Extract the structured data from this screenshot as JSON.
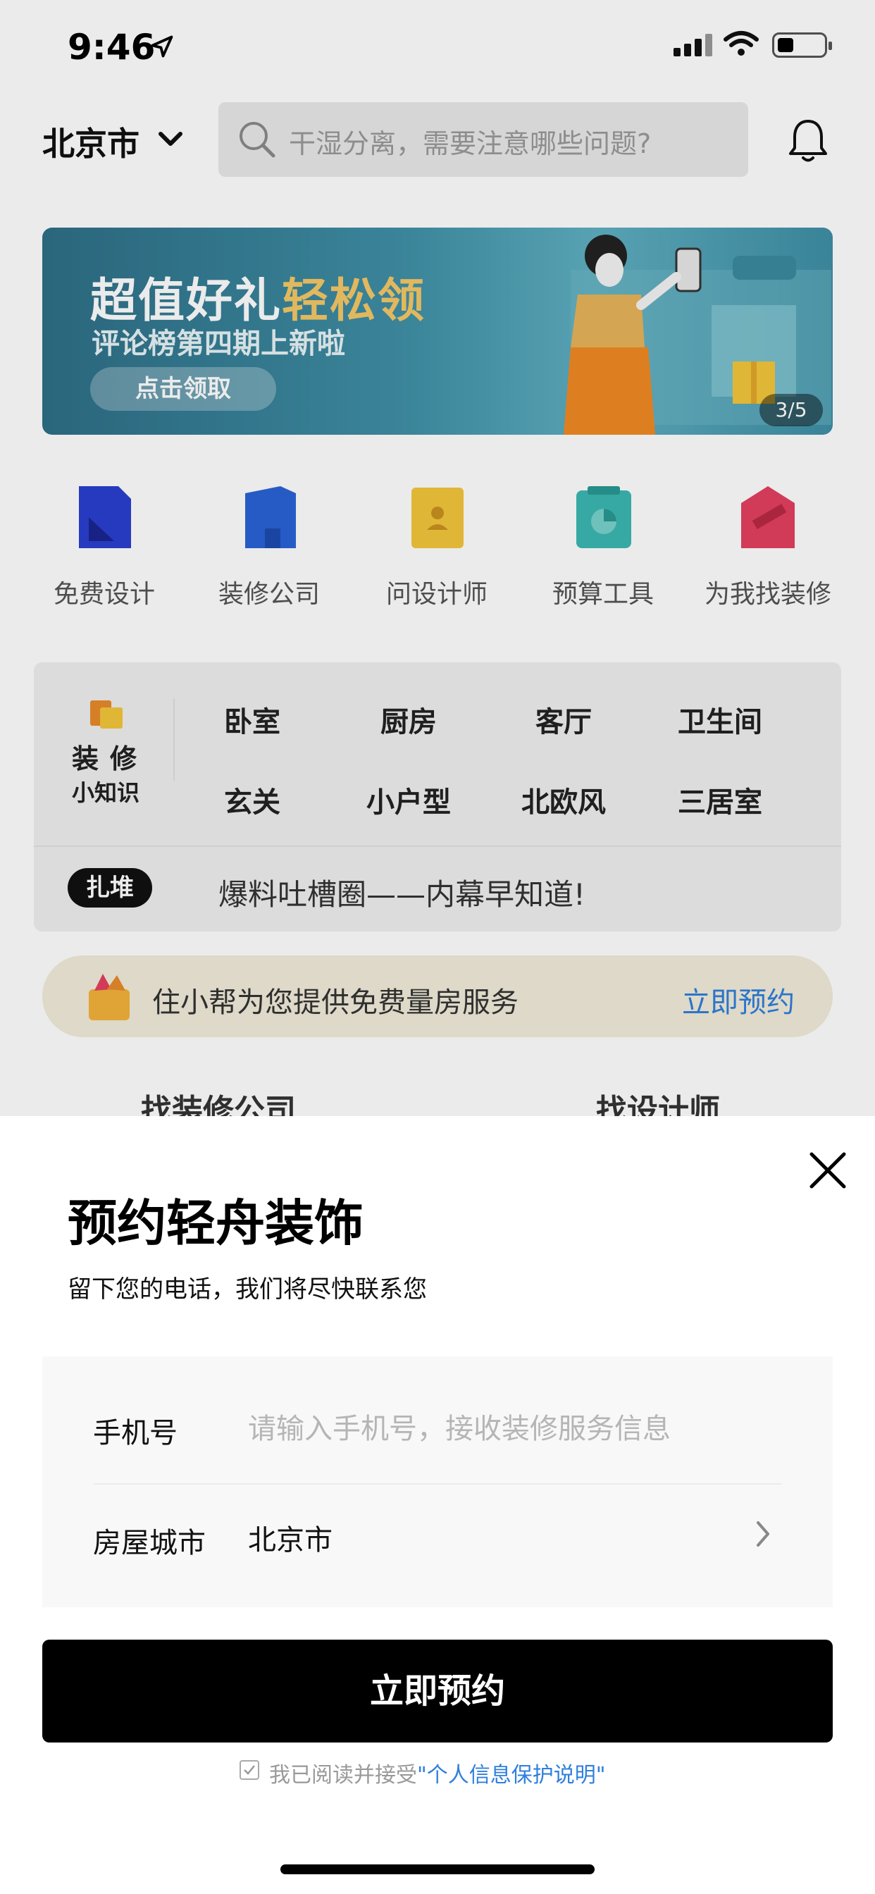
{
  "status": {
    "time": "9:46"
  },
  "header": {
    "city": "北京市",
    "search_placeholder": "干湿分离，需要注意哪些问题?"
  },
  "banner": {
    "title_part1": "超值好礼",
    "title_part2": "轻松领",
    "subtitle": "评论榜第四期上新啦",
    "button": "点击领取",
    "page_indicator": "3/5",
    "colors": {
      "accent": "#f5c866",
      "bg": "#3f8fa6"
    }
  },
  "quick_menu": [
    {
      "label": "免费设计",
      "icon": "blue-triangle-doc-icon",
      "color": "#2a3fd0"
    },
    {
      "label": "装修公司",
      "icon": "building-icon",
      "color": "#2a63d6"
    },
    {
      "label": "问设计师",
      "icon": "designer-book-icon",
      "color": "#f3c63b"
    },
    {
      "label": "预算工具",
      "icon": "budget-chart-icon",
      "color": "#3cb8b2"
    },
    {
      "label": "为我找装修",
      "icon": "house-ruler-icon",
      "color": "#e3405f"
    }
  ],
  "knowledge": {
    "title_line1": "装修",
    "title_line2": "小知识",
    "tags_row1": [
      "卧室",
      "厨房",
      "客厅",
      "卫生间"
    ],
    "tags_row2": [
      "玄关",
      "小户型",
      "北欧风",
      "三居室"
    ],
    "badge": "扎堆",
    "news": "爆料吐槽圈——内幕早知道!"
  },
  "service": {
    "text": "住小帮为您提供免费量房服务",
    "link": "立即预约"
  },
  "tabs_peek": [
    "找装修公司",
    "找设计师"
  ],
  "sheet": {
    "title": "预约轻舟装饰",
    "subtitle": "留下您的电话，我们将尽快联系您",
    "phone_label": "手机号",
    "phone_placeholder": "请输入手机号，接收装修服务信息",
    "city_label": "房屋城市",
    "city_value": "北京市",
    "submit": "立即预约",
    "agree_prefix": "我已阅读并接受",
    "agree_link": "\"个人信息保护说明\""
  }
}
